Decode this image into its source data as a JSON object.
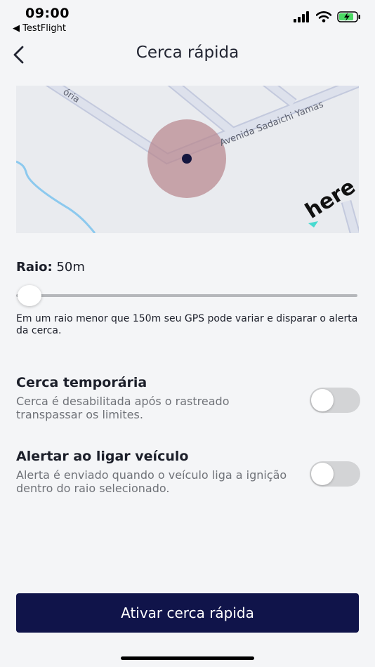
{
  "status_bar": {
    "time": "09:00",
    "back_app": "◀ TestFlight"
  },
  "header": {
    "title": "Cerca rápida"
  },
  "map": {
    "street_labels": [
      "Avenida Sadaichi Yamas",
      "ória"
    ],
    "logo_text": "here",
    "fence_color": "#b9868d"
  },
  "radius": {
    "label": "Raio:",
    "value": "50m",
    "slider_position": 0
  },
  "hint": "Em um raio menor que 150m seu GPS pode variar e disparar o alerta da cerca.",
  "settings": [
    {
      "title": "Cerca temporária",
      "description": "Cerca é desabilitada após o rastreado transpassar os limites.",
      "enabled": false
    },
    {
      "title": "Alertar ao ligar veículo",
      "description": "Alerta é enviado quando o veículo liga a ignição dentro do raio selecionado.",
      "enabled": false
    }
  ],
  "primary_button": {
    "label": "Ativar cerca rápida",
    "color": "#10144a"
  }
}
